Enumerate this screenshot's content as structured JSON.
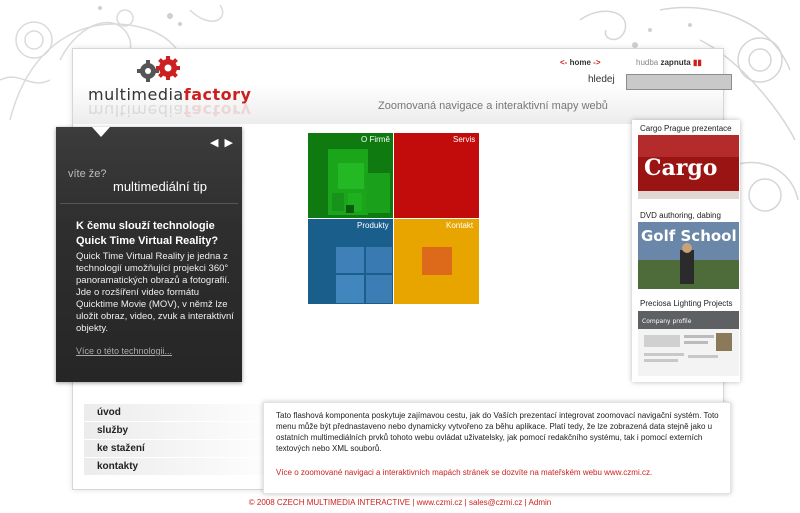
{
  "brand": {
    "logo_main": "multimedia",
    "logo_accent": "factory",
    "accent_color": "#cc1f1f"
  },
  "topnav": {
    "home_left_arrows": "<-",
    "home_label": "home",
    "home_right_arrows": "->",
    "music_label": "hudba",
    "music_state": "zapnuta",
    "music_icon": "equalizer-bars-icon",
    "search_label": "hledej",
    "search_value": ""
  },
  "header": {
    "subtitle": "Zoomovaná navigace a interaktivní mapy webů"
  },
  "tip": {
    "prev_icon": "triangle-left-icon",
    "next_icon": "triangle-right-icon",
    "label": "víte že?",
    "heading": "multimediální tip",
    "question": "K čemu slouží technologie Quick Time Virtual Reality?",
    "body": "Quick Time Virtual Reality je jedna z technologií umožňující projekci 360° panoramatických obrazů a fotografií. Jde o rozšíření video formátu Quicktime Movie (MOV), v němž lze uložit obraz, video, zvuk a interaktivní objekty.",
    "more_link": "Více o této technologii..."
  },
  "treemap": {
    "quadrants": [
      {
        "label": "O Firmě",
        "color": "#0f7a10"
      },
      {
        "label": "Servis",
        "color": "#c20c0c"
      },
      {
        "label": "Produkty",
        "color": "#1a5e8c"
      },
      {
        "label": "Kontakt",
        "color": "#e8a500"
      }
    ]
  },
  "sidebar": {
    "items": [
      {
        "title": "Cargo Prague prezentace",
        "thumb_text": "Cargo"
      },
      {
        "title": "DVD authoring, dabing",
        "thumb_text": "Golf School"
      },
      {
        "title": "Preciosa Lighting Projects",
        "thumb_text": "Company profile"
      }
    ]
  },
  "leftnav": {
    "items": [
      "úvod",
      "služby",
      "ke stažení",
      "kontakty"
    ]
  },
  "info": {
    "text": "Tato flashová komponenta poskytuje zajímavou cestu, jak do Vaších prezentací integrovat zoomovací navigační systém. Toto menu může být přednastaveno nebo dynamicky vytvořeno za běhu aplikace. Platí tedy, že lze zobrazená data stejně jako u ostatních multimediálních prvků tohoto webu ovládat uživatelsky, jak pomocí redakčního systému, tak i pomocí externích textových nebo XML souborů.",
    "link": "Více o zoomované navigaci a interaktivních mapách stránek se dozvíte na mateřském webu www.czmi.cz."
  },
  "footer": {
    "copyright": "© 2008 CZECH MULTIMEDIA INTERACTIVE",
    "sep": " | ",
    "site": "www.czmi.cz",
    "email": "sales@czmi.cz",
    "admin": "Admin"
  }
}
